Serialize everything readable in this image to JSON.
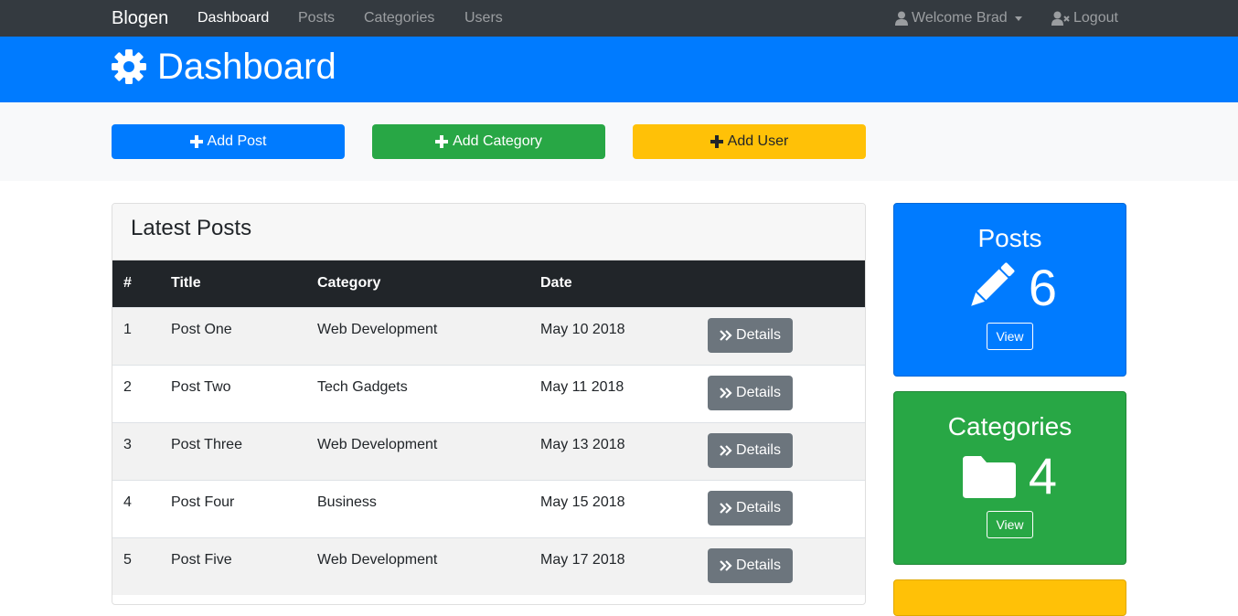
{
  "navbar": {
    "brand": "Blogen",
    "links": [
      "Dashboard",
      "Posts",
      "Categories",
      "Users"
    ],
    "welcome": "Welcome Brad",
    "logout": "Logout"
  },
  "header": {
    "title": "Dashboard"
  },
  "actions": {
    "add_post": "Add Post",
    "add_category": "Add Category",
    "add_user": "Add User"
  },
  "latest_posts": {
    "title": "Latest Posts",
    "columns": [
      "#",
      "Title",
      "Category",
      "Date"
    ],
    "details_label": "Details",
    "rows": [
      {
        "num": "1",
        "title": "Post One",
        "category": "Web Development",
        "date": "May 10 2018"
      },
      {
        "num": "2",
        "title": "Post Two",
        "category": "Tech Gadgets",
        "date": "May 11 2018"
      },
      {
        "num": "3",
        "title": "Post Three",
        "category": "Web Development",
        "date": "May 13 2018"
      },
      {
        "num": "4",
        "title": "Post Four",
        "category": "Business",
        "date": "May 15 2018"
      },
      {
        "num": "5",
        "title": "Post Five",
        "category": "Web Development",
        "date": "May 17 2018"
      }
    ]
  },
  "stats": {
    "posts": {
      "title": "Posts",
      "count": "6",
      "view": "View",
      "icon": "pencil-icon"
    },
    "categories": {
      "title": "Categories",
      "count": "4",
      "view": "View",
      "icon": "folder-icon"
    }
  },
  "colors": {
    "navbar": "#343a40",
    "primary": "#007bff",
    "success": "#28a745",
    "warning": "#ffc107",
    "secondary": "#6c757d",
    "table_head": "#212529"
  }
}
